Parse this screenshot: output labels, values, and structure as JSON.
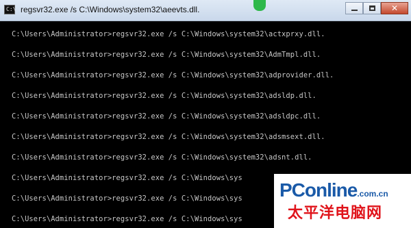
{
  "window": {
    "title": "regsvr32.exe  /s C:\\Windows\\system32\\aeevts.dll.",
    "app_icon": "console-icon",
    "app_icon_glyph": "C:\\"
  },
  "controls": {
    "minimize_icon": "minimize-icon",
    "maximize_icon": "maximize-icon",
    "close_icon": "close-icon",
    "close_glyph": "✕"
  },
  "console": {
    "lines": [
      "C:\\Users\\Administrator>regsvr32.exe /s C:\\Windows\\system32\\actxprxy.dll.",
      "C:\\Users\\Administrator>regsvr32.exe /s C:\\Windows\\system32\\AdmTmpl.dll.",
      "C:\\Users\\Administrator>regsvr32.exe /s C:\\Windows\\system32\\adprovider.dll.",
      "C:\\Users\\Administrator>regsvr32.exe /s C:\\Windows\\system32\\adsldp.dll.",
      "C:\\Users\\Administrator>regsvr32.exe /s C:\\Windows\\system32\\adsldpc.dll.",
      "C:\\Users\\Administrator>regsvr32.exe /s C:\\Windows\\system32\\adsmsext.dll.",
      "C:\\Users\\Administrator>regsvr32.exe /s C:\\Windows\\system32\\adsnt.dll.",
      "C:\\Users\\Administrator>regsvr32.exe /s C:\\Windows\\sys",
      "C:\\Users\\Administrator>regsvr32.exe /s C:\\Windows\\sys",
      "C:\\Users\\Administrator>regsvr32.exe /s C:\\Windows\\sys"
    ],
    "text_color": "#c8c8c8",
    "background": "#000000"
  },
  "watermark": {
    "brand": "PConline",
    "domain": ".com.cn",
    "subtitle": "太平洋电脑网",
    "brand_color": "#1a5aa8",
    "subtitle_color": "#e0141b"
  }
}
